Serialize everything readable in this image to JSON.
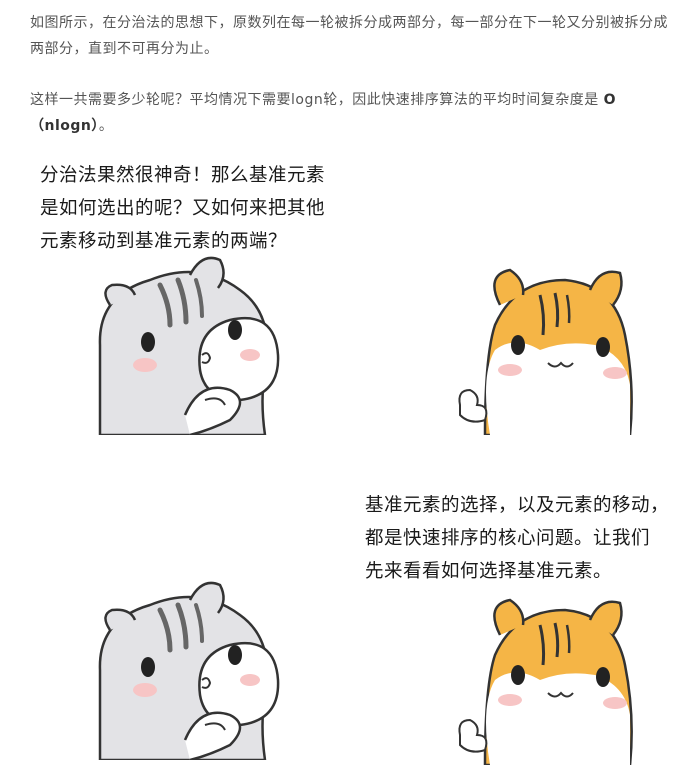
{
  "article": {
    "paragraph1": "如图所示，在分治法的思想下，原数列在每一轮被拆分成两部分，每一部分在下一轮又分别被拆分成两部分，直到不可再分为止。",
    "paragraph2_text": "这样一共需要多少轮呢？平均情况下需要logn轮，因此快速排序算法的平均时间复杂度是 ",
    "paragraph2_bold": "O（nlogn）",
    "paragraph2_end": "。"
  },
  "comic": {
    "panel1": {
      "speech_lines": [
        "分治法果然很神奇！那么基准元素",
        "是如何选出的呢？又如何来把其他",
        "元素移动到基准元素的两端？"
      ]
    },
    "panel2": {
      "speech_lines": [
        "基准元素的选择，以及元素的移动，",
        "都是快速排序的核心问题。让我们",
        "先来看看如何选择基准元素。"
      ]
    }
  },
  "colors": {
    "gray_hamster": "#d9d9dc",
    "orange_hamster": "#f5b546",
    "outline": "#333333",
    "blush": "#f7c5c5"
  }
}
